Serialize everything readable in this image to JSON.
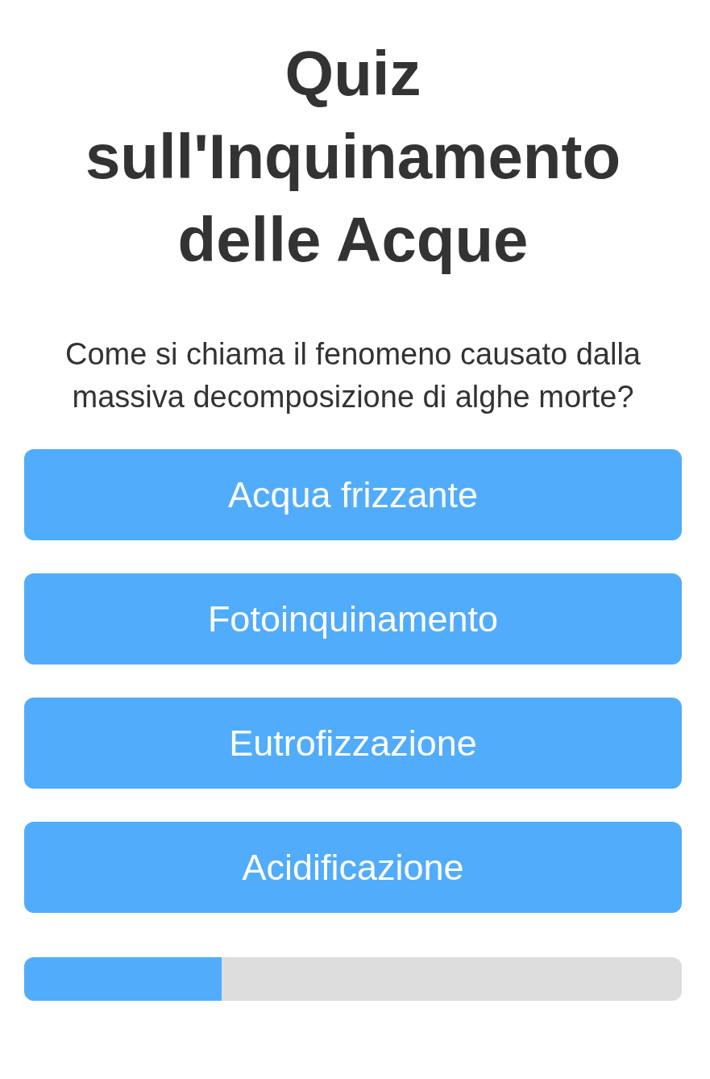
{
  "title": "Quiz sull'Inquinamento delle Acque",
  "question": "Come si chiama il fenomeno causato dalla massiva decomposizione di alghe morte?",
  "answers": [
    "Acqua frizzante",
    "Fotoinquinamento",
    "Eutrofizzazione",
    "Acidificazione"
  ],
  "progress": {
    "level": 0.3
  }
}
